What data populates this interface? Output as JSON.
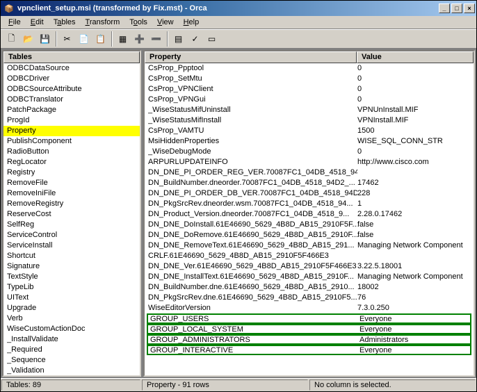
{
  "window": {
    "title": "vpnclient_setup.msi (transformed by Fix.mst) - Orca"
  },
  "menu": {
    "file": "File",
    "edit": "Edit",
    "tables": "Tables",
    "transform": "Transform",
    "tools": "Tools",
    "view": "View",
    "help": "Help"
  },
  "left_panel": {
    "header": "Tables",
    "selected": "Property",
    "items": [
      "ODBCDataSource",
      "ODBCDriver",
      "ODBCSourceAttribute",
      "ODBCTranslator",
      "PatchPackage",
      "ProgId",
      "Property",
      "PublishComponent",
      "RadioButton",
      "RegLocator",
      "Registry",
      "RemoveFile",
      "RemoveIniFile",
      "RemoveRegistry",
      "ReserveCost",
      "SelfReg",
      "ServiceControl",
      "ServiceInstall",
      "Shortcut",
      "Signature",
      "TextStyle",
      "TypeLib",
      "UIText",
      "Upgrade",
      "Verb",
      "WiseCustomActionDoc",
      "_InstallValidate",
      "_Required",
      "_Sequence",
      "_Validation"
    ]
  },
  "right_panel": {
    "col_property": "Property",
    "col_value": "Value",
    "rows": [
      {
        "p": "CsProp_Ppptool",
        "v": "0",
        "hl": false
      },
      {
        "p": "CsProp_SetMtu",
        "v": "0",
        "hl": false
      },
      {
        "p": "CsProp_VPNClient",
        "v": "0",
        "hl": false
      },
      {
        "p": "CsProp_VPNGui",
        "v": "0",
        "hl": false
      },
      {
        "p": "_WiseStatusMifUninstall",
        "v": "VPNUnInstall.MIF",
        "hl": false
      },
      {
        "p": "_WiseStatusMifInstall",
        "v": "VPNInstall.MIF",
        "hl": false
      },
      {
        "p": "CsProp_VAMTU",
        "v": "1500",
        "hl": false
      },
      {
        "p": "MsiHiddenProperties",
        "v": "WISE_SQL_CONN_STR",
        "hl": false
      },
      {
        "p": "_WiseDebugMode",
        "v": "0",
        "hl": false
      },
      {
        "p": "ARPURLUPDATEINFO",
        "v": "http://www.cisco.com",
        "hl": false
      },
      {
        "p": "DN_DNE_PI_ORDER_REG_VER.70087FC1_04DB_4518_94...",
        "v": "",
        "hl": false
      },
      {
        "p": "DN_BuildNumber.dneorder.70087FC1_04DB_4518_94D2_...",
        "v": "17462",
        "hl": false
      },
      {
        "p": "DN_DNE_PI_ORDER_DB_VER.70087FC1_04DB_4518_94D...",
        "v": "228",
        "hl": false
      },
      {
        "p": "DN_PkgSrcRev.dneorder.wsm.70087FC1_04DB_4518_94...",
        "v": "1",
        "hl": false
      },
      {
        "p": "DN_Product_Version.dneorder.70087FC1_04DB_4518_9...",
        "v": "2.28.0.17462",
        "hl": false
      },
      {
        "p": "DN_DNE_DoInstall.61E46690_5629_4B8D_AB15_2910F5F...",
        "v": "false",
        "hl": false
      },
      {
        "p": "DN_DNE_DoRemove.61E46690_5629_4B8D_AB15_2910F...",
        "v": "false",
        "hl": false
      },
      {
        "p": "DN_DNE_RemoveText.61E46690_5629_4B8D_AB15_291...",
        "v": "Managing Network Component",
        "hl": false
      },
      {
        "p": "CRLF.61E46690_5629_4B8D_AB15_2910F5F466E3",
        "v": "",
        "hl": false
      },
      {
        "p": "DN_DNE_Ver.61E46690_5629_4B8D_AB15_2910F5F466E3",
        "v": "3.22.5.18001",
        "hl": false
      },
      {
        "p": "DN_DNE_InstallText.61E46690_5629_4B8D_AB15_2910F...",
        "v": "Managing Network Component",
        "hl": false
      },
      {
        "p": "DN_BuildNumber.dne.61E46690_5629_4B8D_AB15_2910...",
        "v": "18002",
        "hl": false
      },
      {
        "p": "DN_PkgSrcRev.dne.61E46690_5629_4B8D_AB15_2910F5...",
        "v": "76",
        "hl": false
      },
      {
        "p": "WiseEditorVersion",
        "v": "7.3.0.250",
        "hl": false
      },
      {
        "p": "GROUP_USERS",
        "v": "Everyone",
        "hl": true
      },
      {
        "p": "GROUP_LOCAL_SYSTEM",
        "v": "Everyone",
        "hl": true
      },
      {
        "p": "GROUP_ADMINISTRATORS",
        "v": "Administrators",
        "hl": true
      },
      {
        "p": "GROUP_INTERACTIVE",
        "v": "Everyone",
        "hl": true
      }
    ]
  },
  "status": {
    "left": "Tables: 89",
    "mid": "Property - 91 rows",
    "right": "No column is selected."
  }
}
